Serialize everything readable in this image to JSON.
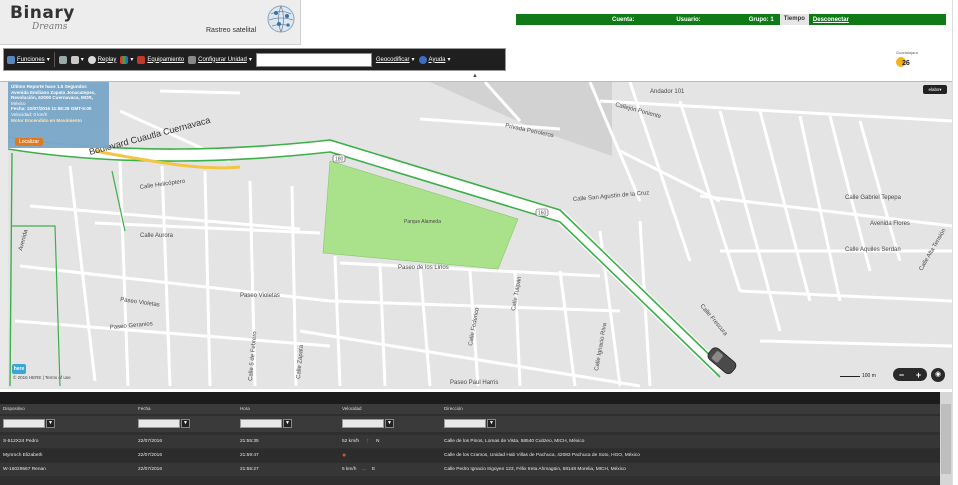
{
  "brand": {
    "name": "Binary",
    "name_sub": "Dreams",
    "tagline": "Rastreo satelital"
  },
  "status_bar": {
    "cuenta_label": "Cuenta:",
    "usuario_label": "Usuario:",
    "grupo_label": "Grupo: 1",
    "tiempo_label": "Tiempo",
    "disconnect_label": "Desconectar"
  },
  "toolbar": {
    "funciones": "Funciones",
    "replay": "Replay",
    "equipamiento": "Equipamiento",
    "configurar": "Configurar Unidad",
    "search_value": "",
    "geocodificar": "Geocodificar",
    "ayuda": "Ayuda"
  },
  "weather": {
    "caption": "Guadalajara",
    "temp": "26"
  },
  "info_panel": {
    "line1": "Último Reporte hace 1.5 Segundos",
    "line2": "Avenida Emiliano Zapata Jonacatepec,",
    "line3": "Revolución, 62000 Cuernavaca, MOR,",
    "line4": "México",
    "line5": "Fecha: 22/07/2016 11:58:28 GMT-5:00",
    "line6": "Velocidad: 0 km/h",
    "line7": "Motor Encendido en Movimiento",
    "locate_label": "Localizar"
  },
  "map": {
    "top_right_btn": "elabs▾",
    "scale_label": "100 m",
    "attribution": "© 2016 HERE | Terms of use",
    "here_logo": "here",
    "zoom_minus": "−",
    "zoom_plus": "+",
    "streets": {
      "boulevard": "Boulevard Cuautla Cuernavaca",
      "andador": "Andador 101",
      "privada_petroleros": "Privada Petroleros",
      "callejon_poniente": "Callejón Poniente",
      "calle_helicoptero": "Calle Helicóptero",
      "calle_aurora": "Calle Aurora",
      "calle_san_agustin": "Calle San Agustín de la Cruz",
      "calle_gabriel": "Calle Gabriel Tepepa",
      "avenida_flores": "Avenida Flores",
      "calle_aquiles": "Calle Aquiles Serdán",
      "calle_alta": "Calle Alta Tensión",
      "paseo_violetas": "Paseo Violetas",
      "paseo_violetas2": "Paseo Violetas",
      "paseo_geranios": "Paseo Geranios",
      "paseo_de_los_lirios": "Paseo de los Lirios",
      "paseo_paul_harris": "Paseo Paul Harris",
      "calle_febrero": "Calle 5 de Febrero",
      "calle_zapata": "Calle Zapata",
      "parque": "Parque Alameda",
      "calle_tulipan": "Calle Tulipán",
      "calle_federico": "Calle Federico",
      "calle_riva": "Calle Ignacio Riva",
      "route_180": "180",
      "route_160": "160",
      "avenida": "Avenida",
      "calle_frescura": "Calle Frescura"
    }
  },
  "grid": {
    "headers": [
      "Dispositivo",
      "Fecha",
      "Hora",
      "Velocidad",
      "Dirección"
    ],
    "rows": [
      {
        "device": "S-512X24 Pedro",
        "date": "22/07/2016",
        "time": "21:55:35",
        "speed": "52 km/h",
        "heading": "N",
        "address": "Calle de los Pinos, Lomas de Vista, 58540 Cuitzeo, MICH, México"
      },
      {
        "device": "Mynroch Elizabeth",
        "date": "22/07/2016",
        "time": "21:59:47",
        "speed": "",
        "heading": "",
        "address": "Calle de los Cramos, Unidad Hab Villas de Pachuca, 42083 Pachuca de Soto, HGO, México"
      },
      {
        "device": "W-16029567 Renan",
        "date": "22/07/2016",
        "time": "21:55:27",
        "speed": "5 km/h",
        "heading": "E",
        "address": "Calle Pedro Ignacio Irigoyen 123, Félix Ireta Ahmagüin, 58148 Morelia, MICH, México"
      }
    ]
  },
  "colors": {
    "status_green": "#0f7a16",
    "toolbar_bg": "#1f1f1f",
    "map_bg": "#e4e4e4",
    "park": "#a9e28a",
    "route_green": "#3db04a",
    "route_yellow": "#f3c542",
    "grid_bg": "#2f2f2f"
  }
}
